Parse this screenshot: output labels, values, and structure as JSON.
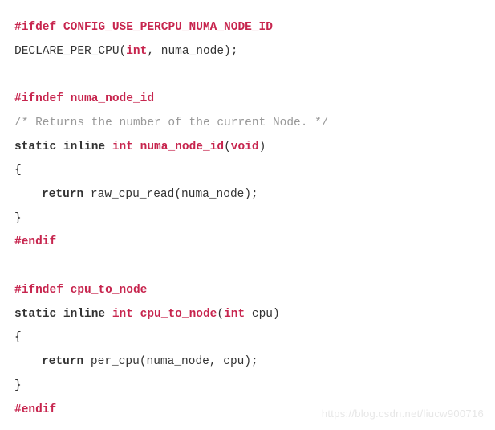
{
  "lines": {
    "l0": {
      "pp0": "#ifdef",
      "id0": "CONFIG_USE_PERCPU_NUMA_NODE_ID"
    },
    "l1": {
      "call": "DECLARE_PER_CPU",
      "lp": "(",
      "ty": "int",
      "c": ", numa_node);"
    },
    "l2": {
      "pp0": "#ifndef",
      "id0": "numa_node_id"
    },
    "l3": {
      "cm": "/* Returns the number of the current Node. */"
    },
    "l4": {
      "kw0": "static",
      "kw1": "inline",
      "ty": "int",
      "fn": "numa_node_id",
      "lp": "(",
      "ty2": "void",
      "rp": ")"
    },
    "l5": {
      "txt": "{"
    },
    "l6": {
      "kw": "return",
      "rest": " raw_cpu_read(numa_node);"
    },
    "l7": {
      "txt": "}"
    },
    "l8": {
      "pp": "#endif"
    },
    "l9": {
      "pp0": "#ifndef",
      "id0": "cpu_to_node"
    },
    "l10": {
      "kw0": "static",
      "kw1": "inline",
      "ty": "int",
      "fn": "cpu_to_node",
      "lp": "(",
      "ty2": "int",
      "rest": " cpu)"
    },
    "l11": {
      "txt": "{"
    },
    "l12": {
      "kw": "return",
      "rest": " per_cpu(numa_node, cpu);"
    },
    "l13": {
      "txt": "}"
    },
    "l14": {
      "pp": "#endif"
    }
  },
  "watermark": "https://blog.csdn.net/liucw900716"
}
